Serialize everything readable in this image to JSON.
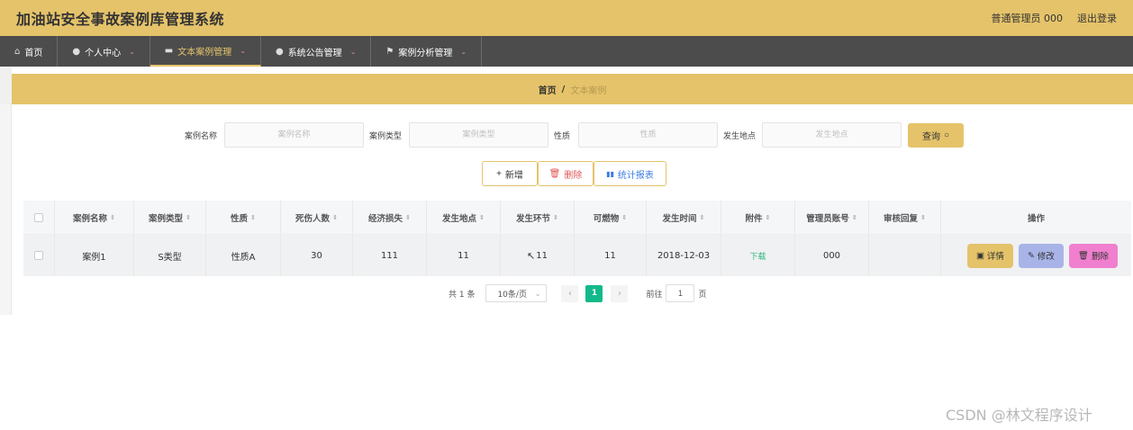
{
  "header": {
    "title": "加油站安全事故案例库管理系统",
    "user_label": "普通管理员 000",
    "logout_label": "退出登录"
  },
  "nav": {
    "items": [
      {
        "label": "首页",
        "icon": "home-icon"
      },
      {
        "label": "个人中心",
        "icon": "user-icon"
      },
      {
        "label": "文本案例管理",
        "icon": "monitor-icon",
        "active": true
      },
      {
        "label": "系统公告管理",
        "icon": "location-icon"
      },
      {
        "label": "案例分析管理",
        "icon": "flag-icon"
      }
    ]
  },
  "breadcrumb": {
    "home": "首页",
    "separator": "/",
    "current": "文本案例"
  },
  "search": {
    "fields": [
      {
        "label": "案例名称",
        "placeholder": "案例名称"
      },
      {
        "label": "案例类型",
        "placeholder": "案例类型"
      },
      {
        "label": "性质",
        "placeholder": "性质"
      },
      {
        "label": "发生地点",
        "placeholder": "发生地点"
      }
    ],
    "query_label": "查询"
  },
  "actions": {
    "add_label": "新增",
    "delete_label": "删除",
    "report_label": "统计报表"
  },
  "table": {
    "columns": [
      "案例名称",
      "案例类型",
      "性质",
      "死伤人数",
      "经济损失",
      "发生地点",
      "发生环节",
      "可燃物",
      "发生时间",
      "附件",
      "管理员账号",
      "审核回复",
      "操作"
    ],
    "rows": [
      {
        "name": "案例1",
        "type": "S类型",
        "nature": "性质A",
        "casualties": "30",
        "loss": "111",
        "location": "11",
        "stage": "11",
        "combustible": "11",
        "time": "2018-12-03",
        "attachment": "下载",
        "admin": "000",
        "reply": ""
      }
    ],
    "op_labels": {
      "detail": "详情",
      "edit": "修改",
      "delete": "删除"
    }
  },
  "pagination": {
    "total": "共 1 条",
    "page_size": "10条/页",
    "current": "1",
    "goto_prefix": "前往",
    "goto_value": "1",
    "goto_suffix": "页"
  },
  "watermark": "CSDN @林文程序设计",
  "colors": {
    "accent": "#e5c36a",
    "nav_bg": "#4c4c4c",
    "pager_active": "#13b98a",
    "edit_btn": "#a8b4e8",
    "delete_btn": "#f07fcf",
    "download_link": "#2db77a"
  }
}
